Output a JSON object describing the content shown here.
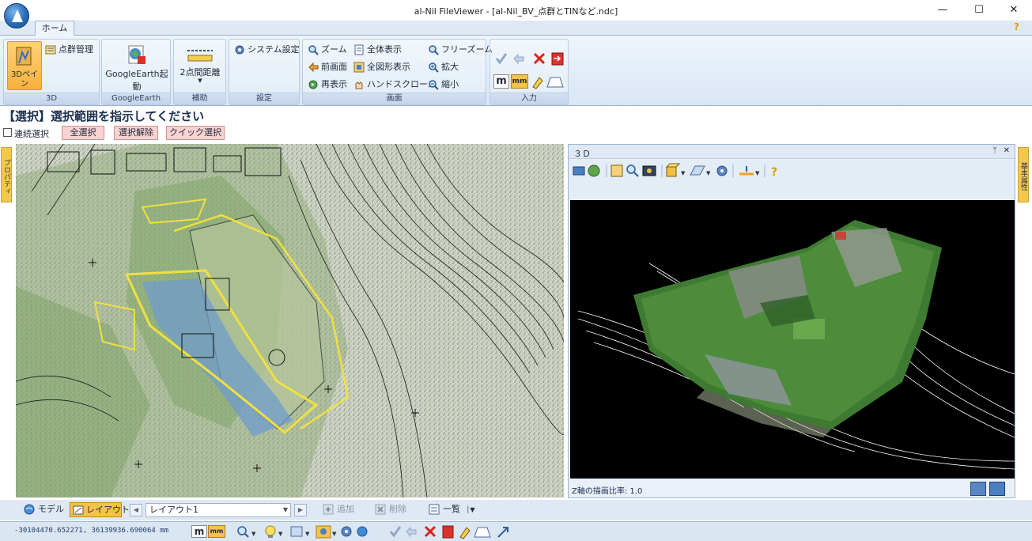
{
  "window": {
    "title": "al-Nil FileViewer - [al-Nil_BV_点群とTINなど.ndc]",
    "minimize": "—",
    "maximize": "☐",
    "close": "✕"
  },
  "ribbon": {
    "tabs": [
      "ホーム"
    ],
    "help": "?",
    "groups": [
      {
        "label": "3D",
        "buttons": [
          "3Dペイン",
          "点群管理"
        ]
      },
      {
        "label": "GoogleEarth",
        "buttons": [
          "GoogleEarth起動"
        ]
      },
      {
        "label": "補助",
        "buttons": [
          "2点間距離"
        ]
      },
      {
        "label": "設定",
        "buttons": [
          "システム設定"
        ]
      },
      {
        "label": "画面",
        "buttons": [
          "ズーム",
          "前画面",
          "再表示",
          "全体表示",
          "全図形表示",
          "ハンドスクロール",
          "フリーズーム",
          "拡大",
          "縮小"
        ]
      },
      {
        "label": "入力",
        "buttons": [
          "m",
          "mm"
        ]
      }
    ]
  },
  "selection": {
    "title": "【選択】選択範囲を指示してください",
    "continuous_label": "連続選択",
    "buttons": [
      "全選択",
      "選択解除",
      "クイック選択"
    ]
  },
  "side_tabs": {
    "left": "プロパティ",
    "right": "基本属性"
  },
  "pane3d": {
    "title": "３Ｄ",
    "pin": "ᛘ",
    "close": "✕",
    "zscale_label": "Z軸の描画比率: 1.0"
  },
  "layout_bar": {
    "model_tab": "モデル",
    "layout_tab": "レイアウト",
    "layout_select": "レイアウト1",
    "prev": "◀",
    "next": "▶",
    "add": "追加",
    "delete": "削除",
    "list": "一覧"
  },
  "status": {
    "coords": "-30104470.652271, 36139936.690064 mm",
    "unit_m": "m",
    "unit_mm": "mm"
  },
  "colors": {
    "ribbon_bg": "#dfe9f5",
    "accent_yellow": "#f3c84b",
    "pink_button": "#fbd2d2",
    "canvas_bg": "#000000"
  }
}
